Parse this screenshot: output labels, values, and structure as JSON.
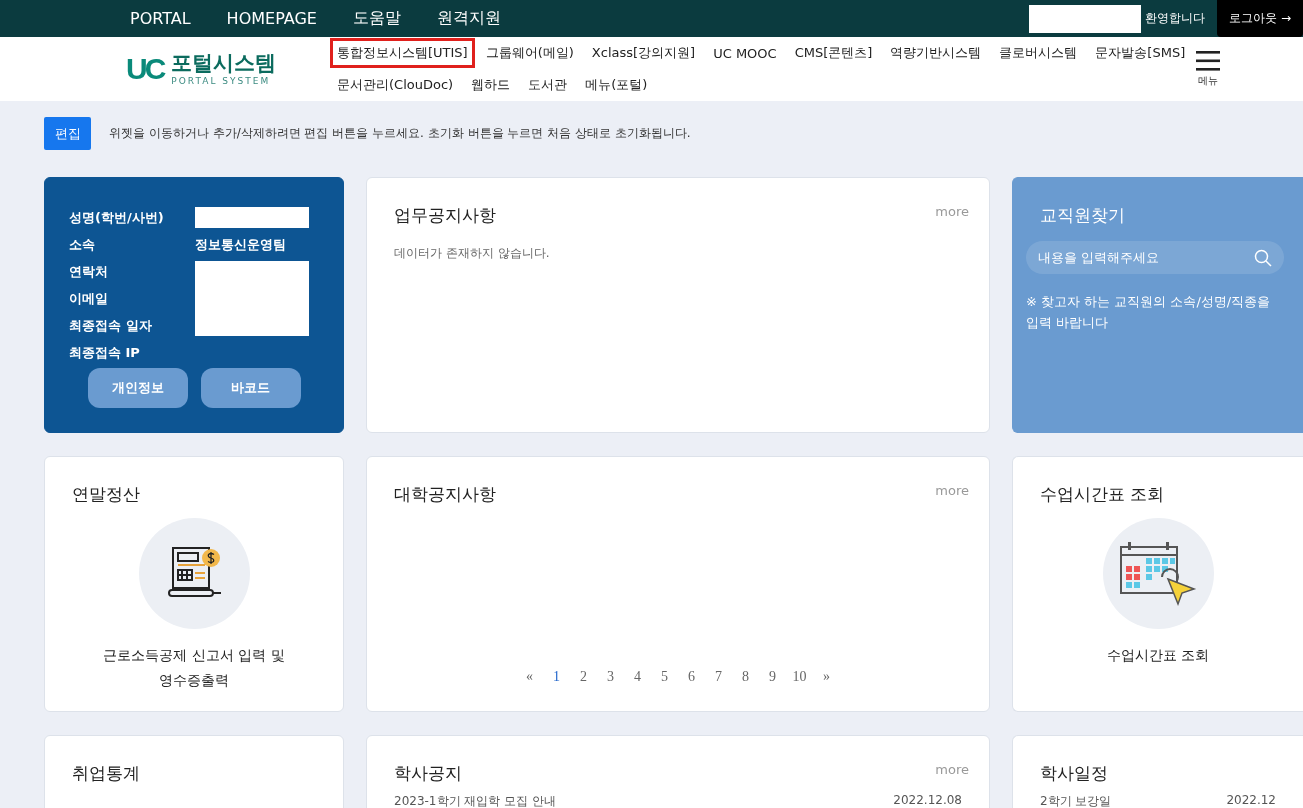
{
  "top_bar": {
    "links": [
      "PORTAL",
      "HOMEPAGE",
      "도움말",
      "원격지원"
    ],
    "welcome": "환영합니다",
    "logout": "로그아웃 →"
  },
  "header": {
    "logo": {
      "mark": "UC",
      "title": "포털시스템",
      "subtitle": "PORTAL SYSTEM"
    },
    "menu_rows": [
      [
        {
          "label": "통합정보시스템[UTIS]",
          "selected": true
        },
        {
          "label": "그룹웨어(메일)",
          "selected": false
        },
        {
          "label": "Xclass[강의지원]",
          "selected": false
        },
        {
          "label": "UC MOOC",
          "selected": false
        },
        {
          "label": "CMS[콘텐츠]",
          "selected": false
        },
        {
          "label": "역량기반시스템",
          "selected": false
        },
        {
          "label": "클로버시스템",
          "selected": false
        },
        {
          "label": "문자발송[SMS]",
          "selected": false
        }
      ],
      [
        {
          "label": "문서관리(ClouDoc)",
          "selected": false
        },
        {
          "label": "웹하드",
          "selected": false
        },
        {
          "label": "도서관",
          "selected": false
        },
        {
          "label": "메뉴(포털)",
          "selected": false
        }
      ]
    ],
    "menu_button": "메뉴"
  },
  "edit_bar": {
    "button": "편집",
    "hint": "위젯을 이동하거나 추가/삭제하려면 편집 버튼을 누르세요. 초기화 버튼을 누르면 처음 상태로 초기화됩니다."
  },
  "widgets": [
    {
      "kind": "profile",
      "rows": [
        {
          "label": "성명(학번/사번)",
          "redacted": true
        },
        {
          "label": "소속",
          "value": "정보통신운영팀",
          "redacted": false
        },
        {
          "label": "연락처",
          "redacted": true
        },
        {
          "label": "이메일",
          "redacted": true
        },
        {
          "label": "최종접속 일자",
          "redacted": true
        },
        {
          "label": "최종접속 IP",
          "redacted": false
        }
      ],
      "buttons": [
        "개인정보",
        "바코드"
      ]
    },
    {
      "kind": "board",
      "title": "업무공지사항",
      "more": "more",
      "empty": "데이터가 존재하지 않습니다."
    },
    {
      "kind": "search",
      "title": "교직원찾기",
      "placeholder": "내용을 입력해주세요",
      "note": "※ 찾고자 하는 교직원의 소속/성명/직종을 입력 바랍니다"
    },
    {
      "kind": "shortcut",
      "title": "연말정산",
      "caption": "근로소득공제 신고서 입력 및\n영수증출력"
    },
    {
      "kind": "board",
      "title": "대학공지사항",
      "more": "more",
      "pages": [
        {
          "label": "«",
          "selected": false
        },
        {
          "label": "1",
          "selected": true
        },
        {
          "label": "2",
          "selected": false
        },
        {
          "label": "3",
          "selected": false
        },
        {
          "label": "4",
          "selected": false
        },
        {
          "label": "5",
          "selected": false
        },
        {
          "label": "6",
          "selected": false
        },
        {
          "label": "7",
          "selected": false
        },
        {
          "label": "8",
          "selected": false
        },
        {
          "label": "9",
          "selected": false
        },
        {
          "label": "10",
          "selected": false
        },
        {
          "label": "»",
          "selected": false
        }
      ]
    },
    {
      "kind": "shortcut",
      "title": "수업시간표 조회",
      "caption": "수업시간표 조회"
    },
    {
      "kind": "shortcut",
      "title": "취업통계"
    },
    {
      "kind": "board",
      "title": "학사공지",
      "more": "more",
      "items": [
        {
          "title": "2023-1학기 재입학 모집 안내",
          "date": "2022.12.08"
        }
      ]
    },
    {
      "kind": "board",
      "title": "학사일정",
      "items": [
        {
          "title": "2학기 보강일",
          "date": "2022.12"
        }
      ]
    }
  ]
}
